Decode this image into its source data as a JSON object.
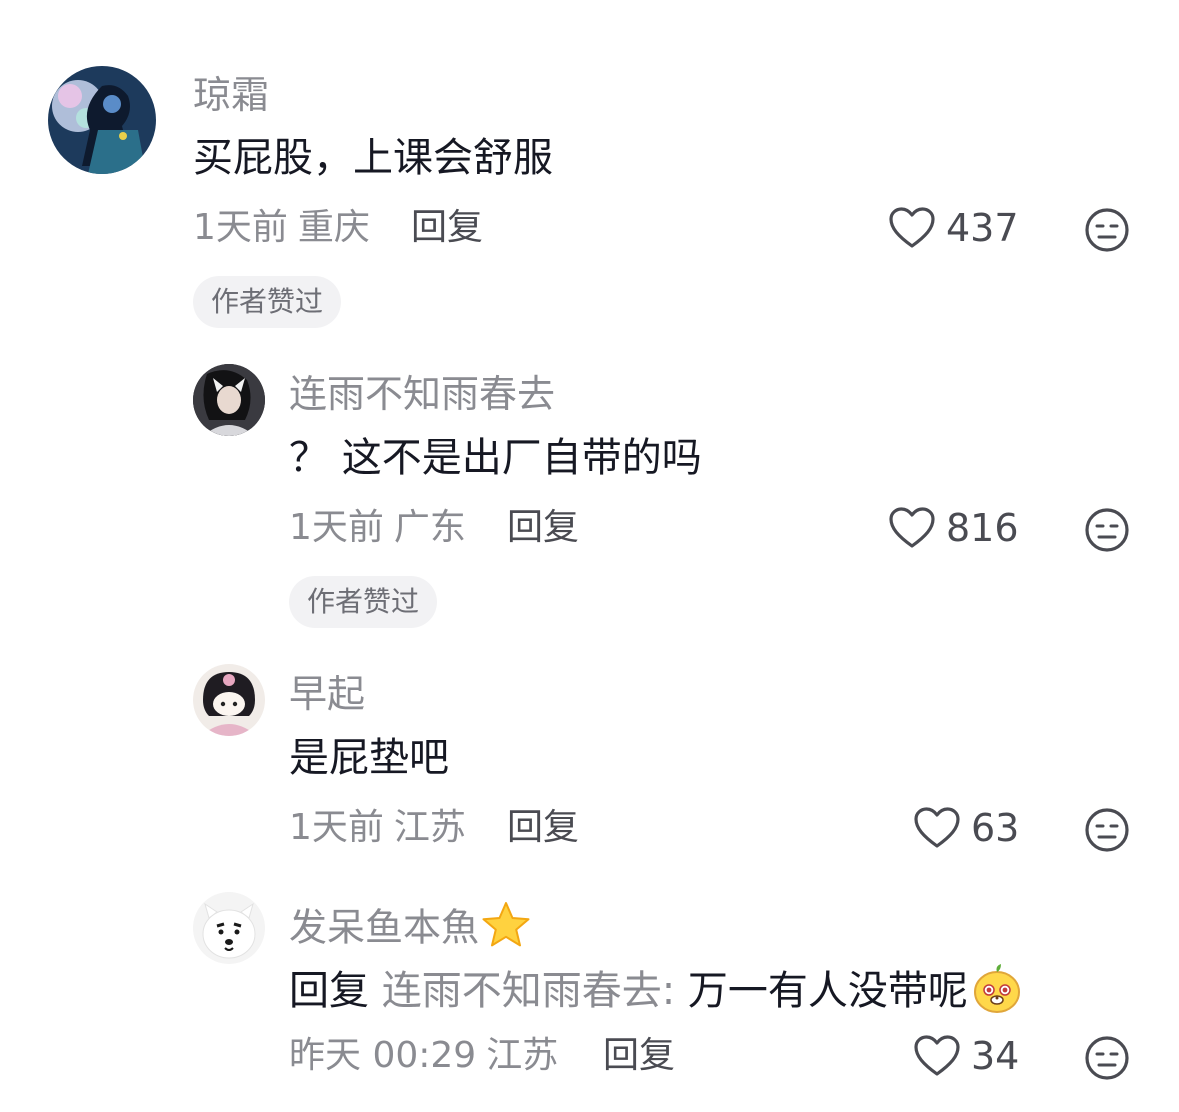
{
  "comments": [
    {
      "username": "琼霜",
      "text": "买屁股，上课会舒服",
      "time": "1天前",
      "location": "重庆",
      "reply_label": "回复",
      "likes": "437",
      "author_liked_label": "作者赞过",
      "avatar_icon": "avatar-dark-anime"
    },
    {
      "username": "连雨不知雨春去",
      "text": "？ 这不是出厂自带的吗",
      "time": "1天前",
      "location": "广东",
      "reply_label": "回复",
      "likes": "816",
      "author_liked_label": "作者赞过",
      "avatar_icon": "avatar-girl-photo"
    },
    {
      "username": "早起",
      "text": "是屁垫吧",
      "time": "1天前",
      "location": "江苏",
      "reply_label": "回复",
      "likes": "63",
      "avatar_icon": "avatar-kuromi-plush"
    },
    {
      "username": "发呆鱼本魚",
      "username_emoji": "star-icon",
      "reply_prefix": "回复",
      "reply_to": "连雨不知雨春去:",
      "text": "万一有人没带呢",
      "text_emoji": "face-emoji-icon",
      "time": "昨天 00:29",
      "location": "江苏",
      "reply_label": "回复",
      "likes": "34",
      "avatar_icon": "avatar-samoyed-dog"
    }
  ],
  "colors": {
    "primary_text": "#161823",
    "secondary_text": "#8a8b91",
    "badge_bg": "#f2f2f4"
  }
}
